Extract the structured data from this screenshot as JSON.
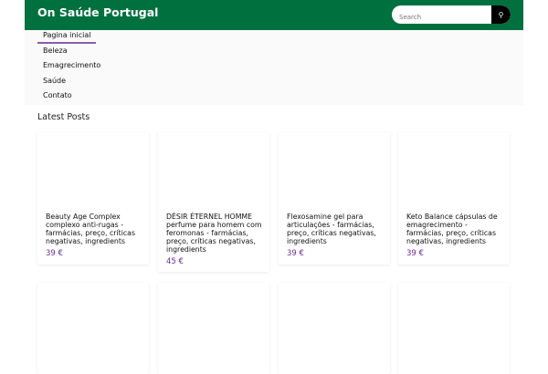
{
  "header": {
    "title": "On Saúde Portugal",
    "search_placeholder": "Search",
    "search_icon": "search-icon"
  },
  "nav": {
    "items": [
      {
        "label": "Pagina inicial"
      },
      {
        "label": "Beleza"
      },
      {
        "label": "Emagrecimento"
      },
      {
        "label": "Saúde"
      },
      {
        "label": "Contato"
      }
    ]
  },
  "main": {
    "heading": "Latest Posts",
    "posts": [
      {
        "title": "Beauty Age Complex complexo anti-rugas - farmácias, preço, críticas negativas, ingredients",
        "price": "39 €"
      },
      {
        "title": "DÉSIR ÉTERNEL HOMME perfume para homem com feromonas - farmácias, preço, críticas negativas, ingredients",
        "price": "45 €"
      },
      {
        "title": "Flexosamine gel para articulações - farmácias, preço, críticas negativas, ingredients",
        "price": "39 €"
      },
      {
        "title": "Keto Balance cápsulas de emagrecimento - farmácias, preço, críticas negativas, ingredients",
        "price": "39 €"
      }
    ]
  },
  "colors": {
    "header": "#00703f",
    "accent": "#6a2c91"
  }
}
